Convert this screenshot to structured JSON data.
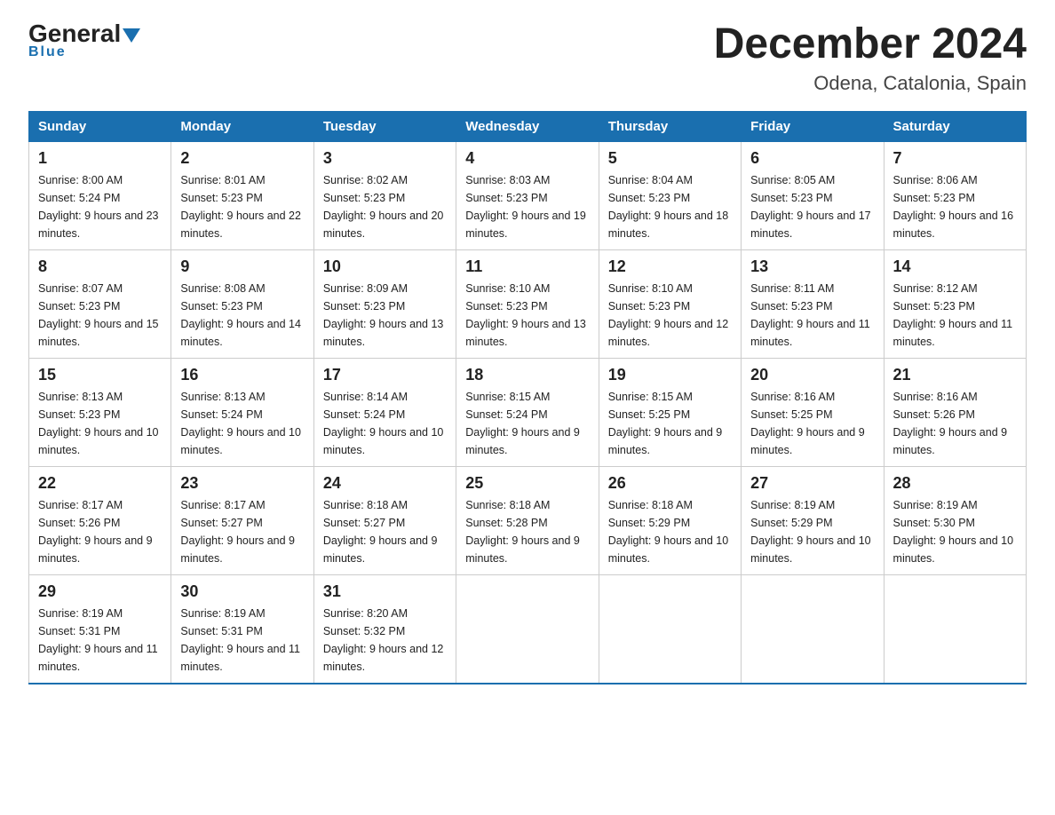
{
  "header": {
    "title": "December 2024",
    "subtitle": "Odena, Catalonia, Spain",
    "logo_general": "General",
    "logo_blue": "Blue"
  },
  "weekdays": [
    "Sunday",
    "Monday",
    "Tuesday",
    "Wednesday",
    "Thursday",
    "Friday",
    "Saturday"
  ],
  "weeks": [
    [
      {
        "day": "1",
        "sunrise": "8:00 AM",
        "sunset": "5:24 PM",
        "daylight": "9 hours and 23 minutes."
      },
      {
        "day": "2",
        "sunrise": "8:01 AM",
        "sunset": "5:23 PM",
        "daylight": "9 hours and 22 minutes."
      },
      {
        "day": "3",
        "sunrise": "8:02 AM",
        "sunset": "5:23 PM",
        "daylight": "9 hours and 20 minutes."
      },
      {
        "day": "4",
        "sunrise": "8:03 AM",
        "sunset": "5:23 PM",
        "daylight": "9 hours and 19 minutes."
      },
      {
        "day": "5",
        "sunrise": "8:04 AM",
        "sunset": "5:23 PM",
        "daylight": "9 hours and 18 minutes."
      },
      {
        "day": "6",
        "sunrise": "8:05 AM",
        "sunset": "5:23 PM",
        "daylight": "9 hours and 17 minutes."
      },
      {
        "day": "7",
        "sunrise": "8:06 AM",
        "sunset": "5:23 PM",
        "daylight": "9 hours and 16 minutes."
      }
    ],
    [
      {
        "day": "8",
        "sunrise": "8:07 AM",
        "sunset": "5:23 PM",
        "daylight": "9 hours and 15 minutes."
      },
      {
        "day": "9",
        "sunrise": "8:08 AM",
        "sunset": "5:23 PM",
        "daylight": "9 hours and 14 minutes."
      },
      {
        "day": "10",
        "sunrise": "8:09 AM",
        "sunset": "5:23 PM",
        "daylight": "9 hours and 13 minutes."
      },
      {
        "day": "11",
        "sunrise": "8:10 AM",
        "sunset": "5:23 PM",
        "daylight": "9 hours and 13 minutes."
      },
      {
        "day": "12",
        "sunrise": "8:10 AM",
        "sunset": "5:23 PM",
        "daylight": "9 hours and 12 minutes."
      },
      {
        "day": "13",
        "sunrise": "8:11 AM",
        "sunset": "5:23 PM",
        "daylight": "9 hours and 11 minutes."
      },
      {
        "day": "14",
        "sunrise": "8:12 AM",
        "sunset": "5:23 PM",
        "daylight": "9 hours and 11 minutes."
      }
    ],
    [
      {
        "day": "15",
        "sunrise": "8:13 AM",
        "sunset": "5:23 PM",
        "daylight": "9 hours and 10 minutes."
      },
      {
        "day": "16",
        "sunrise": "8:13 AM",
        "sunset": "5:24 PM",
        "daylight": "9 hours and 10 minutes."
      },
      {
        "day": "17",
        "sunrise": "8:14 AM",
        "sunset": "5:24 PM",
        "daylight": "9 hours and 10 minutes."
      },
      {
        "day": "18",
        "sunrise": "8:15 AM",
        "sunset": "5:24 PM",
        "daylight": "9 hours and 9 minutes."
      },
      {
        "day": "19",
        "sunrise": "8:15 AM",
        "sunset": "5:25 PM",
        "daylight": "9 hours and 9 minutes."
      },
      {
        "day": "20",
        "sunrise": "8:16 AM",
        "sunset": "5:25 PM",
        "daylight": "9 hours and 9 minutes."
      },
      {
        "day": "21",
        "sunrise": "8:16 AM",
        "sunset": "5:26 PM",
        "daylight": "9 hours and 9 minutes."
      }
    ],
    [
      {
        "day": "22",
        "sunrise": "8:17 AM",
        "sunset": "5:26 PM",
        "daylight": "9 hours and 9 minutes."
      },
      {
        "day": "23",
        "sunrise": "8:17 AM",
        "sunset": "5:27 PM",
        "daylight": "9 hours and 9 minutes."
      },
      {
        "day": "24",
        "sunrise": "8:18 AM",
        "sunset": "5:27 PM",
        "daylight": "9 hours and 9 minutes."
      },
      {
        "day": "25",
        "sunrise": "8:18 AM",
        "sunset": "5:28 PM",
        "daylight": "9 hours and 9 minutes."
      },
      {
        "day": "26",
        "sunrise": "8:18 AM",
        "sunset": "5:29 PM",
        "daylight": "9 hours and 10 minutes."
      },
      {
        "day": "27",
        "sunrise": "8:19 AM",
        "sunset": "5:29 PM",
        "daylight": "9 hours and 10 minutes."
      },
      {
        "day": "28",
        "sunrise": "8:19 AM",
        "sunset": "5:30 PM",
        "daylight": "9 hours and 10 minutes."
      }
    ],
    [
      {
        "day": "29",
        "sunrise": "8:19 AM",
        "sunset": "5:31 PM",
        "daylight": "9 hours and 11 minutes."
      },
      {
        "day": "30",
        "sunrise": "8:19 AM",
        "sunset": "5:31 PM",
        "daylight": "9 hours and 11 minutes."
      },
      {
        "day": "31",
        "sunrise": "8:20 AM",
        "sunset": "5:32 PM",
        "daylight": "9 hours and 12 minutes."
      },
      null,
      null,
      null,
      null
    ]
  ]
}
